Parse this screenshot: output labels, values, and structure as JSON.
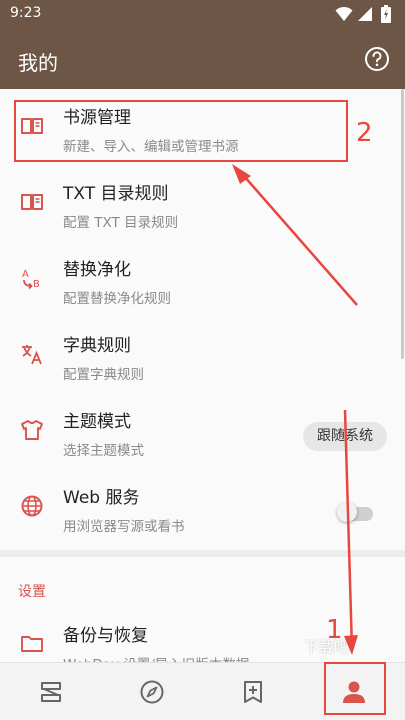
{
  "status_bar": {
    "time": "9:23",
    "icons": [
      "wifi-icon",
      "signal-icon",
      "battery-icon"
    ]
  },
  "app_bar": {
    "title": "我的",
    "help_icon": "help-circle-icon"
  },
  "menu": {
    "items": [
      {
        "title": "书源管理",
        "subtitle": "新建、导入、编辑或管理书源",
        "icon": "book-open-icon"
      },
      {
        "title": "TXT 目录规则",
        "subtitle": "配置 TXT 目录规则",
        "icon": "book-open-icon"
      },
      {
        "title": "替换净化",
        "subtitle": "配置替换净化规则",
        "icon": "replace-ab-icon"
      },
      {
        "title": "字典规则",
        "subtitle": "配置字典规则",
        "icon": "translate-icon"
      },
      {
        "title": "主题模式",
        "subtitle": "选择主题模式",
        "icon": "shirt-icon",
        "value": "跟随系统"
      },
      {
        "title": "Web 服务",
        "subtitle": "用浏览器写源或看书",
        "icon": "globe-icon",
        "toggle_on": false
      }
    ],
    "section_label": "设置",
    "settings_items": [
      {
        "title": "备份与恢复",
        "subtitle": "WebDav 设置/导入旧版本数据",
        "icon": "folder-icon"
      }
    ]
  },
  "bottom_nav": {
    "items": [
      {
        "icon": "bookshelf-icon"
      },
      {
        "icon": "compass-icon"
      },
      {
        "icon": "rss-add-icon"
      },
      {
        "icon": "person-icon",
        "active": true
      }
    ]
  },
  "annotations": {
    "label_1": "1",
    "label_2": "2",
    "color": "#e8473f"
  },
  "watermark": "下载吧",
  "colors": {
    "app_bar": "#6d5646",
    "accent": "#d9534f"
  }
}
